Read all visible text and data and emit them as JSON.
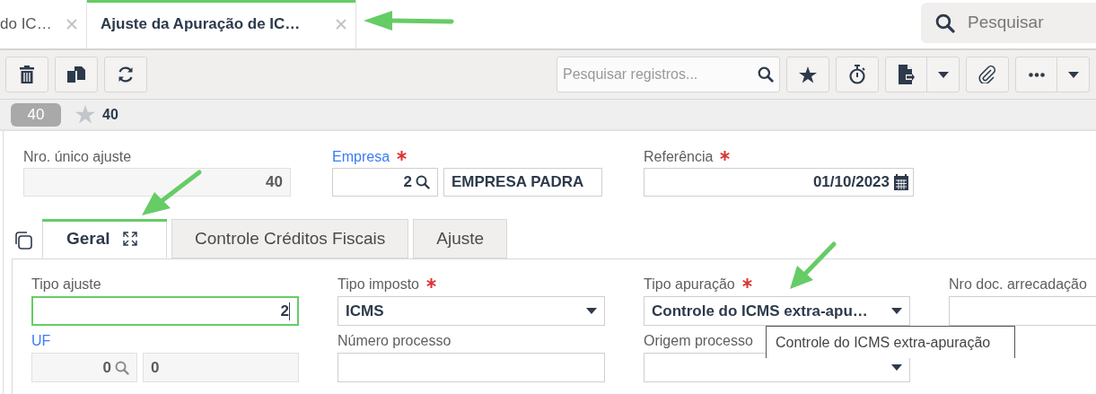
{
  "doc_tabs": [
    {
      "label": "do IC…",
      "selected": false
    },
    {
      "label": "Ajuste da Apuração de IC…",
      "selected": true
    }
  ],
  "global_search": {
    "placeholder": "Pesquisar"
  },
  "toolbar": {
    "search": {
      "placeholder": "Pesquisar registros..."
    }
  },
  "record": {
    "badge": "40",
    "number": "40"
  },
  "header_fields": [
    {
      "label": "Nro. único ajuste",
      "kind": "number",
      "value": "40",
      "disabled": true,
      "required": false,
      "link": false
    },
    {
      "label": "Empresa",
      "kind": "lookup",
      "value": "2",
      "description": "EMPRESA PADRA",
      "disabled": false,
      "required": true,
      "link": true
    },
    {
      "label": "Referência",
      "kind": "date",
      "value": "01/10/2023",
      "disabled": false,
      "required": true,
      "link": false
    }
  ],
  "form_tabs": [
    {
      "label": "Geral",
      "selected": true
    },
    {
      "label": "Controle Créditos Fiscais",
      "selected": false
    },
    {
      "label": "Ajuste",
      "selected": false
    }
  ],
  "panel_fields": [
    {
      "label": "Tipo ajuste",
      "kind": "number",
      "value": "2",
      "focused": true,
      "disabled": false,
      "required": false,
      "link": false
    },
    {
      "label": "Tipo imposto",
      "kind": "select",
      "value": "ICMS",
      "focused": false,
      "disabled": false,
      "required": true,
      "link": false
    },
    {
      "label": "Tipo apuração",
      "kind": "select",
      "value": "Controle do ICMS extra-apu…",
      "focused": false,
      "disabled": false,
      "required": true,
      "link": false
    },
    {
      "label": "Nro doc. arrecadação",
      "kind": "text",
      "focused": false,
      "disabled": false,
      "required": false,
      "link": false
    },
    {
      "label": "UF",
      "kind": "lookup",
      "value": "0",
      "description": "0",
      "focused": false,
      "disabled": true,
      "required": false,
      "link": true
    },
    {
      "label": "Número processo",
      "kind": "text",
      "focused": false,
      "disabled": false,
      "required": false,
      "link": false
    },
    {
      "label": "Origem processo",
      "kind": "select",
      "focused": false,
      "disabled": false,
      "required": false,
      "link": false
    }
  ],
  "tooltip": "Controle do ICMS extra-apuração"
}
